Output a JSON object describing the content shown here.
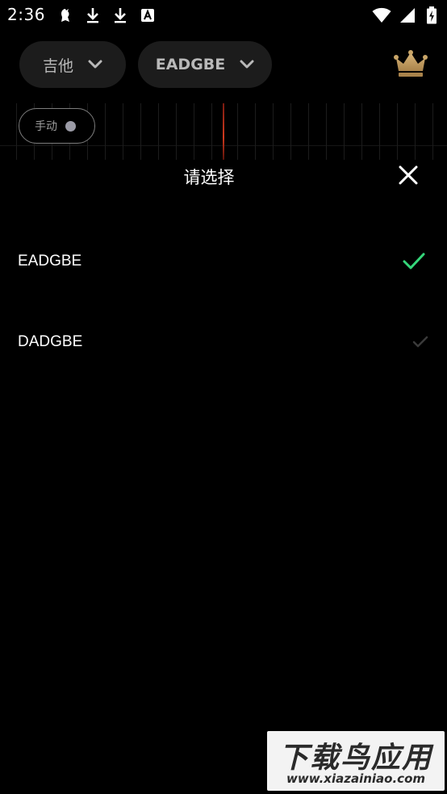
{
  "status_bar": {
    "time": "2:36",
    "left_icons": [
      "notification-app-icon",
      "download-icon",
      "download-icon",
      "font-app-icon"
    ],
    "right_icons": [
      "wifi-icon",
      "cellular-signal-icon",
      "battery-charging-icon"
    ]
  },
  "header": {
    "instrument_label": "吉他",
    "tuning_label": "EADGBE",
    "premium_icon": "crown-icon",
    "premium_color": "#c9a568"
  },
  "mode_toggle": {
    "label": "手动"
  },
  "sheet": {
    "title": "请选择",
    "options": [
      {
        "label": "EADGBE",
        "selected": true,
        "check_color": "#35d67a"
      },
      {
        "label": "DADGBE",
        "selected": false,
        "check_color": "#3a3a3a"
      }
    ]
  },
  "watermark": {
    "title": "下载鸟应用",
    "url": "www.xiazainiao.com"
  },
  "colors": {
    "background": "#000000",
    "pill_background": "#1c1c1c",
    "tuner_needle": "#d23a1e"
  }
}
